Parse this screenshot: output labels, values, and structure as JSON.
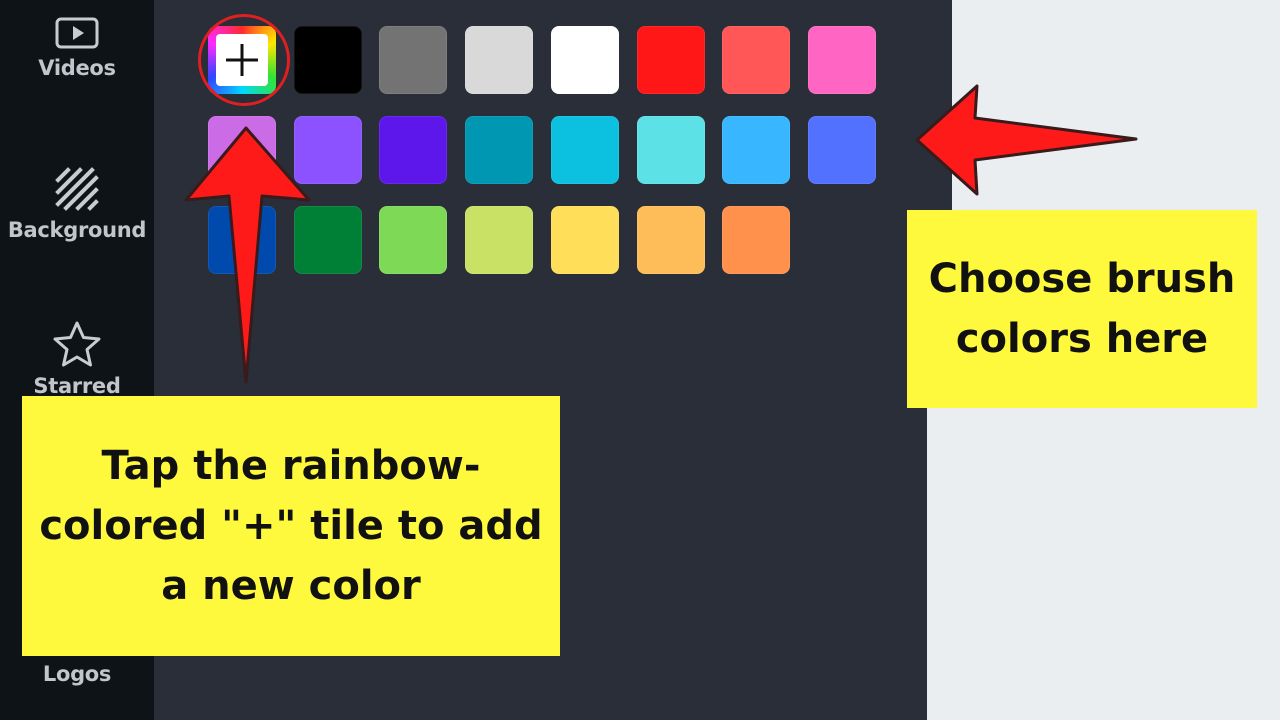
{
  "sidebar": {
    "items": [
      {
        "label": "Videos",
        "icon": "video-icon"
      },
      {
        "label": "Background",
        "icon": "background-icon"
      },
      {
        "label": "Starred",
        "icon": "star-icon"
      },
      {
        "label": "Logos",
        "icon": "logos-icon"
      }
    ]
  },
  "palette": {
    "add_tile_symbol": "+",
    "colors": [
      "#000000",
      "#737373",
      "#d9d9d9",
      "#ffffff",
      "#ff1616",
      "#ff5757",
      "#ff66c4",
      "#cb6ce6",
      "#8c52ff",
      "#5e17eb",
      "#0097b2",
      "#0cc0df",
      "#5ce1e6",
      "#38b6ff",
      "#5271ff",
      "#004aad",
      "#008037",
      "#7ed957",
      "#c9e265",
      "#ffde59",
      "#ffbd59",
      "#ff914d"
    ]
  },
  "annotations": {
    "add_color_note": "Tap the rainbow-colored \"+\" tile to add a new color",
    "brush_colors_note": "Choose brush colors here"
  }
}
